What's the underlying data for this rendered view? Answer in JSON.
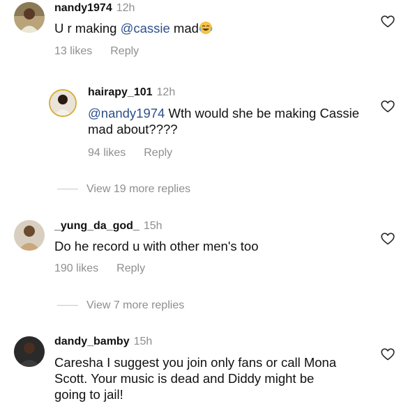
{
  "comments": [
    {
      "username": "nandy1974",
      "time": "12h",
      "mention": "",
      "text_before": "U r making ",
      "inline_mention": "@cassie",
      "text_after": " mad",
      "emoji": "laughing-crying-emoji",
      "likes": "13 likes",
      "reply": "Reply"
    },
    {
      "username": "hairapy_101",
      "time": "12h",
      "mention": "@nandy1974",
      "text": " Wth would she be making Cassie mad about????",
      "likes": "94 likes",
      "reply": "Reply"
    },
    {
      "username": "_yung_da_god_",
      "time": "15h",
      "text": "Do he record u with other men's too",
      "likes": "190 likes",
      "reply": "Reply"
    },
    {
      "username": "dandy_bamby",
      "time": "15h",
      "text": "Caresha I suggest you join only fans or call Mona Scott. Your music is dead and Diddy might be going to jail!"
    }
  ],
  "view_more": [
    "View 19 more replies",
    "View 7 more replies"
  ],
  "icons": {
    "like": "heart-outline-icon"
  },
  "colors": {
    "mention": "#2d4f8b",
    "secondary_text": "#8e8e8e",
    "primary_text": "#111111"
  }
}
